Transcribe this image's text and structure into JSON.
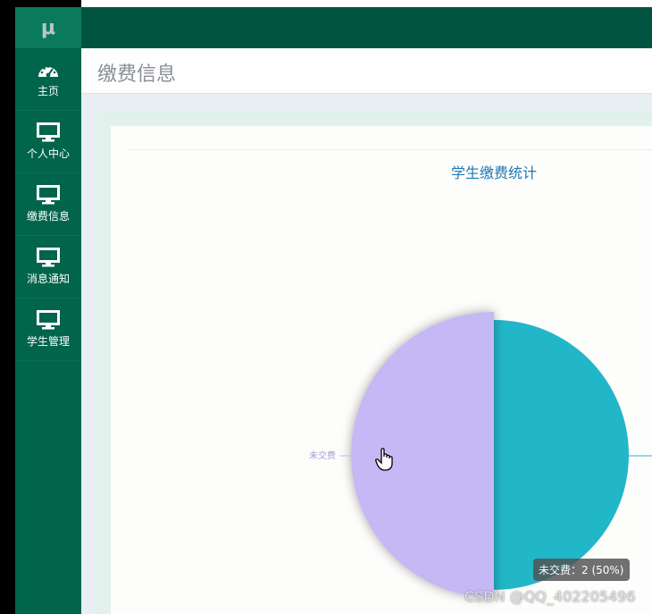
{
  "sidebar": {
    "logo": "μ",
    "items": [
      {
        "label": "主页",
        "icon": "dashboard-icon"
      },
      {
        "label": "个人中心",
        "icon": "monitor-icon"
      },
      {
        "label": "缴费信息",
        "icon": "monitor-icon"
      },
      {
        "label": "消息通知",
        "icon": "monitor-icon"
      },
      {
        "label": "学生管理",
        "icon": "monitor-icon"
      }
    ]
  },
  "header": {
    "title": "缴费信息"
  },
  "chart_data": {
    "type": "pie",
    "title": "学生缴费统计",
    "slices": [
      {
        "name": "未交费",
        "value": 2,
        "percent": 50,
        "color": "#c6b8f4"
      },
      {
        "name": "",
        "value": 2,
        "percent": 50,
        "color": "#22b6c9"
      }
    ]
  },
  "tooltip": {
    "text": "未交费：2 (50%)"
  },
  "watermark": "CSDN @QQ_402205496",
  "colors": {
    "sidebar": "#00654a",
    "topbar": "#00533f"
  }
}
